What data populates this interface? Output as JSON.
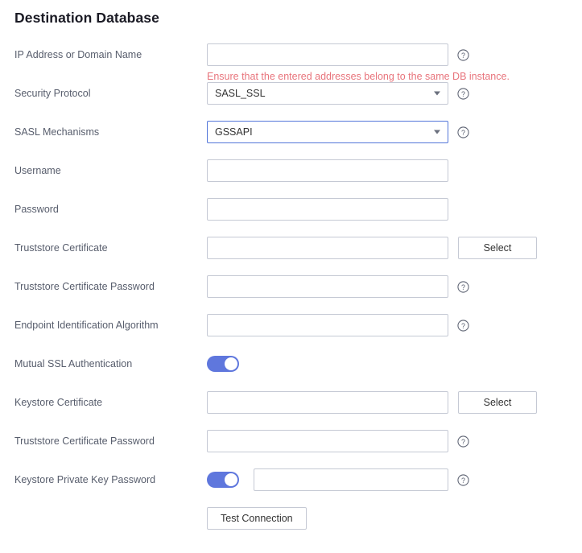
{
  "page": {
    "title": "Destination Database"
  },
  "icons": {
    "help": "help-circle-icon",
    "caret": "chevron-down-icon"
  },
  "colors": {
    "toggle_on": "#5f77dd",
    "focus_border": "#5376d9",
    "hint_text": "#e8747c",
    "label_text": "#575d6c",
    "border": "#c5c9d4"
  },
  "fields": {
    "ip_address": {
      "label": "IP Address or Domain Name",
      "value": "",
      "placeholder": "",
      "hint": "Ensure that the entered addresses belong to the same DB instance."
    },
    "security_protocol": {
      "label": "Security Protocol",
      "value": "SASL_SSL"
    },
    "sasl_mechanisms": {
      "label": "SASL Mechanisms",
      "value": "GSSAPI"
    },
    "username": {
      "label": "Username",
      "value": "",
      "placeholder": ""
    },
    "password": {
      "label": "Password",
      "value": "",
      "placeholder": ""
    },
    "truststore_certificate": {
      "label": "Truststore Certificate",
      "value": "",
      "placeholder": "",
      "button": "Select"
    },
    "truststore_certificate_password": {
      "label": "Truststore Certificate Password",
      "value": "",
      "placeholder": ""
    },
    "endpoint_identification_algorithm": {
      "label": "Endpoint Identification Algorithm",
      "value": "",
      "placeholder": ""
    },
    "mutual_ssl_authentication": {
      "label": "Mutual SSL Authentication",
      "state": "on"
    },
    "keystore_certificate": {
      "label": "Keystore Certificate",
      "value": "",
      "placeholder": "",
      "button": "Select"
    },
    "keystore_truststore_certificate_password": {
      "label": "Truststore Certificate Password",
      "value": "",
      "placeholder": ""
    },
    "keystore_private_key_password": {
      "label": "Keystore Private Key Password",
      "state": "on",
      "value": "",
      "placeholder": ""
    }
  },
  "actions": {
    "test_connection": "Test Connection"
  }
}
